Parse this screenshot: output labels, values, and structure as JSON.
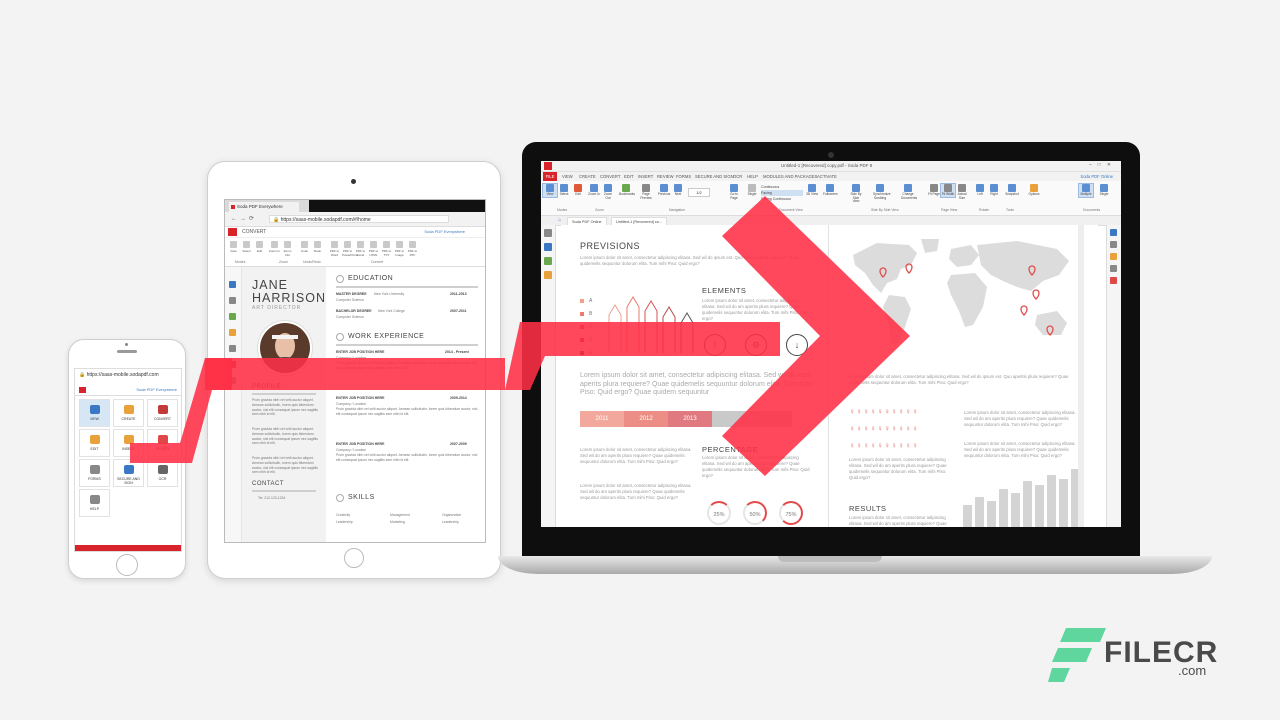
{
  "phone": {
    "url": "https://saas-mobile.sodapdf.com",
    "online_link": "Soda PDF Everywhere",
    "tiles": [
      "VIEW",
      "CREATE",
      "CONVERT",
      "EDIT",
      "INSERT",
      "REVIEW",
      "FORMS",
      "SECURE AND SIGN",
      "OCR",
      "HELP"
    ]
  },
  "tablet": {
    "tab_title": "Soda PDF Everywhere",
    "url": "https://saas-mobile.sodapdf.com/#/home",
    "ribbon_title": "CONVERT",
    "online_link": "Soda PDF Everywhere",
    "ribbon_buttons": [
      "View",
      "Select",
      "Edit",
      "Zoom In",
      "Zoom Out",
      "Undo",
      "Redo",
      "PDF to Word",
      "PDF to PowerPoint",
      "PDF to Excel",
      "PDF to HTML",
      "PDF to TXT",
      "PDF to Image",
      "PDF to RTF"
    ],
    "ribbon_groups": [
      "Modes",
      "Zoom",
      "Undo/Redo",
      "Convert"
    ],
    "cv": {
      "first_name": "JANE",
      "last_name": "HARRISON",
      "role": "ART DIRECTOR",
      "education_title": "EDUCATION",
      "education": [
        {
          "degree": "MASTER DEGREE",
          "school": "New York University",
          "field": "Computer Science",
          "years": "2011-2013"
        },
        {
          "degree": "BACHELOR DEGREE",
          "school": "New York College",
          "field": "Computer Science",
          "years": "2007-2011"
        }
      ],
      "work_title": "WORK EXPERIENCE",
      "jobs": [
        {
          "title": "ENTER JOB POSITION HERE",
          "company": "Company / Location",
          "years": "2014 - Present"
        },
        {
          "title": "ENTER JOB POSITION HERE",
          "company": "Company / Location",
          "years": "2009-2014"
        },
        {
          "title": "ENTER JOB POSITION HERE",
          "company": "Company / Location",
          "years": "2007-2009"
        }
      ],
      "profile_title": "PROFILE",
      "contact_title": "CONTACT",
      "phone": "Tel. 212-123-1234",
      "skills_title": "SKILLS",
      "skills": [
        "Creativity",
        "Management",
        "Organization",
        "Leadership",
        "Marketing",
        "Leadership"
      ],
      "lorem": "Proin gravida nibh vel velit auctor aliquet. Aenean sollicitudin, lorem quis bibendum auctor, nisi elit consequat ipsum nec sagittis sem nibh id elit."
    }
  },
  "laptop": {
    "window_title": "Untitled-1 [Recovered] copy.pdf - Soda PDF 8",
    "menu": [
      "FILE",
      "VIEW",
      "CREATE",
      "CONVERT",
      "EDIT",
      "INSERT",
      "REVIEW",
      "FORMS",
      "SECURE AND SIGN",
      "OCR",
      "HELP",
      "MODULES AND PACKAGES",
      "ACTIVATE"
    ],
    "online_link": "Soda PDF Online",
    "ribbon_buttons": [
      "View",
      "Select",
      "Edit",
      "Zoom In",
      "Zoom Out",
      "Bookmarks",
      "Page Preview",
      "Previous",
      "Next",
      "Go to Page",
      "Single",
      "3D View",
      "Fullscreen",
      "Side By Side View",
      "Synchronize Scrolling",
      "Change Documents",
      "Fit Page",
      "Fit Width",
      "Actual Size",
      "Left",
      "Right",
      "Snapshot",
      "Options",
      "Multiple",
      "Single"
    ],
    "page_counter": "1/2",
    "page_view_options": [
      "Continuous",
      "Facing",
      "Facing Continuous"
    ],
    "ribbon_groups": [
      "Modes",
      "Zoom",
      "Navigation",
      "Document View",
      "Side By Side View",
      "Page View",
      "Rotate",
      "Tools",
      "Documents"
    ],
    "tabs": [
      "Soda PDF Online",
      "Untitled-1 [Recovered] co..."
    ],
    "infographic": {
      "previsions": "PREVISIONS",
      "elements": "ELEMENTS",
      "percentage": "PERCENTAGE",
      "results": "RESULTS",
      "legend": [
        "A",
        "B",
        "C",
        "D",
        "E"
      ],
      "timeline": [
        "2011",
        "2012",
        "2013",
        "2014"
      ],
      "pcts": [
        "25%",
        "50%",
        "75%"
      ],
      "intro": "Lorem ipsum dolor sit amet, consectetur adipiscing elitasa. Sed wil do ipsum est. Quo aperitis plura requiere? Quae quidemelis sequuntur dolorum elita. Tum mihi Piso: Quid ergo?",
      "big": "Lorem ipsum dolor sit amet, consectetur adipiscing elitasa. Sed wil do eum aperits plura requiere? Quae quidemelis sequuntur dolorum elita. Tum mihi Piso: Quid ergo? Quae quidem sequuntur",
      "small": "Lorem ipsum dolor sit amet, consectetur adipiscing elitasa. Sed wil do am aperits plura requiere? Quae quidemelis sequuntur dolorum elita. Tum mihi Piso: Quid ergo?"
    }
  },
  "watermark": {
    "brand": "FILECR",
    "tld": ".com"
  },
  "colors": {
    "soda_red": "#d8232a",
    "overlay_red": "#ff2f45",
    "watermark_green": "#5fd69e"
  }
}
